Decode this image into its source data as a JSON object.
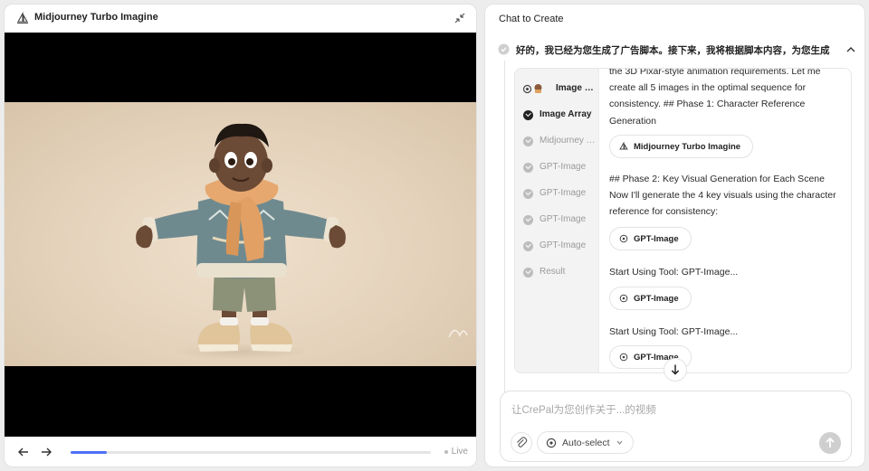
{
  "left": {
    "title": "Midjourney Turbo Imagine",
    "playback": {
      "progress": 0.1,
      "live_label": "Live"
    }
  },
  "right": {
    "title": "Chat to Create",
    "message": "好的，我已经为您生成了广告脚本。接下来，我将根据脚本内容，为您生成",
    "steps": [
      {
        "label": "Image Reference",
        "state": "emoji"
      },
      {
        "label": "Image Array",
        "state": "active"
      },
      {
        "label": "Midjourney Turbo Imagine",
        "state": "done"
      },
      {
        "label": "GPT-Image",
        "state": "done"
      },
      {
        "label": "GPT-Image",
        "state": "done"
      },
      {
        "label": "GPT-Image",
        "state": "done"
      },
      {
        "label": "GPT-Image",
        "state": "done"
      },
      {
        "label": "Result",
        "state": "done"
      }
    ],
    "content": {
      "para1": "the 3D Pixar-style animation requirements. Let me create all 5 images in the optimal sequence for consistency. ## Phase 1: Character Reference Generation",
      "tool1": "Midjourney Turbo Imagine",
      "para2": "## Phase 2: Key Visual Generation for Each Scene Now I'll generate the 4 key visuals using the character reference for consistency:",
      "tool2": "GPT-Image",
      "para3": "Start Using Tool: GPT-Image...",
      "tool3": "GPT-Image",
      "para4": "Start Using Tool: GPT-Image...",
      "tool4": "GPT-Image"
    },
    "input": {
      "placeholder": "让CrePal为您创作关于...的视频",
      "mode_label": "Auto-select"
    }
  },
  "colors": {
    "accent": "#4f6ef7",
    "panel_bg": "#ffffff",
    "page_bg": "#ededed"
  },
  "icons": [
    "sail-icon",
    "collapse-icon",
    "back-arrow-icon",
    "forward-arrow-icon",
    "check-icon",
    "chevron-up-icon",
    "gpt-icon",
    "down-arrow-icon",
    "paperclip-icon",
    "send-arrow-icon"
  ]
}
